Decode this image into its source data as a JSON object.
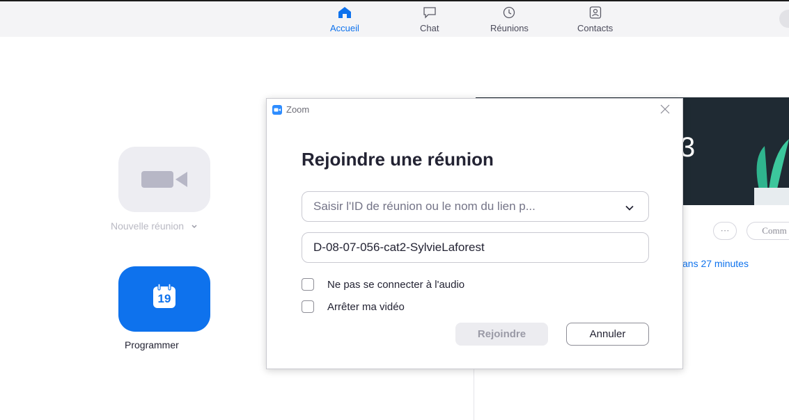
{
  "nav": {
    "items": [
      {
        "label": "Accueil",
        "icon": "home-icon",
        "active": true
      },
      {
        "label": "Chat",
        "icon": "chat-icon",
        "active": false
      },
      {
        "label": "Réunions",
        "icon": "clock-icon",
        "active": false
      },
      {
        "label": "Contacts",
        "icon": "contacts-icon",
        "active": false
      }
    ]
  },
  "home": {
    "new_meeting_label": "Nouvelle réunion",
    "schedule_label": "Programmer",
    "calendar_day": "19"
  },
  "background_panel": {
    "banner_digit": "3",
    "more_button": "···",
    "comment_button": "Comm",
    "countdown_text": "ans 27 minutes"
  },
  "dialog": {
    "window_title": "Zoom",
    "heading": "Rejoindre une réunion",
    "meeting_id_placeholder": "Saisir l'ID de réunion ou le nom du lien p...",
    "name_value": "D-08-07-056-cat2-SylvieLaforest",
    "checkbox_audio_label": "Ne pas se connecter à l'audio",
    "checkbox_video_label": "Arrêter ma vidéo",
    "checkbox_audio_checked": false,
    "checkbox_video_checked": false,
    "join_label": "Rejoindre",
    "cancel_label": "Annuler"
  },
  "colors": {
    "accent": "#0e72ed",
    "banner_bg": "#1f2a33",
    "disabled_tile": "#ededf2"
  }
}
